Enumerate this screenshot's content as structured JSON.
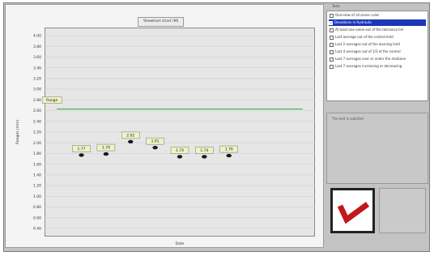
{
  "chart": {
    "title": "Shewhart chart (M)",
    "xlabel": "Date",
    "ylabel": "Ranges (mm)",
    "range_label": "Range",
    "colors": {
      "range_line": "#3cb043",
      "markers": "#1a1a1a",
      "label_fill": "#eef2c4"
    }
  },
  "chart_data": {
    "type": "line",
    "ylim": [
      0.4,
      4.0
    ],
    "yticks": [
      "4.00",
      "3.80",
      "3.60",
      "3.40",
      "3.20",
      "3.00",
      "2.80",
      "2.60",
      "2.40",
      "2.20",
      "2.00",
      "1.80",
      "1.60",
      "1.40",
      "1.20",
      "1.00",
      "0.80",
      "0.60",
      "0.40"
    ],
    "range_value": 2.63,
    "range_x": [
      0,
      10
    ],
    "points": [
      {
        "x": 1.0,
        "y": 1.77,
        "label": "1.77"
      },
      {
        "x": 2.0,
        "y": 1.79,
        "label": "1.79"
      },
      {
        "x": 3.0,
        "y": 2.02,
        "label": "2.02"
      },
      {
        "x": 4.0,
        "y": 1.91,
        "label": "1.91"
      },
      {
        "x": 5.0,
        "y": 1.74,
        "label": "1.74"
      },
      {
        "x": 6.0,
        "y": 1.74,
        "label": "1.74"
      },
      {
        "x": 7.0,
        "y": 1.76,
        "label": "1.76"
      }
    ],
    "xlim": [
      -0.5,
      10.5
    ]
  },
  "tests": {
    "header": "Tests",
    "items": [
      {
        "label": "Overview of all seven rules",
        "selected": false
      },
      {
        "label": "Deviations in Hydraulic",
        "selected": true
      },
      {
        "label": "At least one value out of the tolerance lim",
        "selected": false
      },
      {
        "label": "Last average out of the control limit",
        "selected": false
      },
      {
        "label": "Last 2 averages out of the warning limit",
        "selected": false
      },
      {
        "label": "Last 4 averages out of 1/3 of the control",
        "selected": false
      },
      {
        "label": "Last 7 averages over or under the mediane",
        "selected": false
      },
      {
        "label": "Last 7 averages increasing or decreasing",
        "selected": false
      }
    ]
  },
  "result": {
    "text": "The test is satisfied"
  },
  "status": {
    "mark": "check",
    "color": "#c4161c"
  }
}
